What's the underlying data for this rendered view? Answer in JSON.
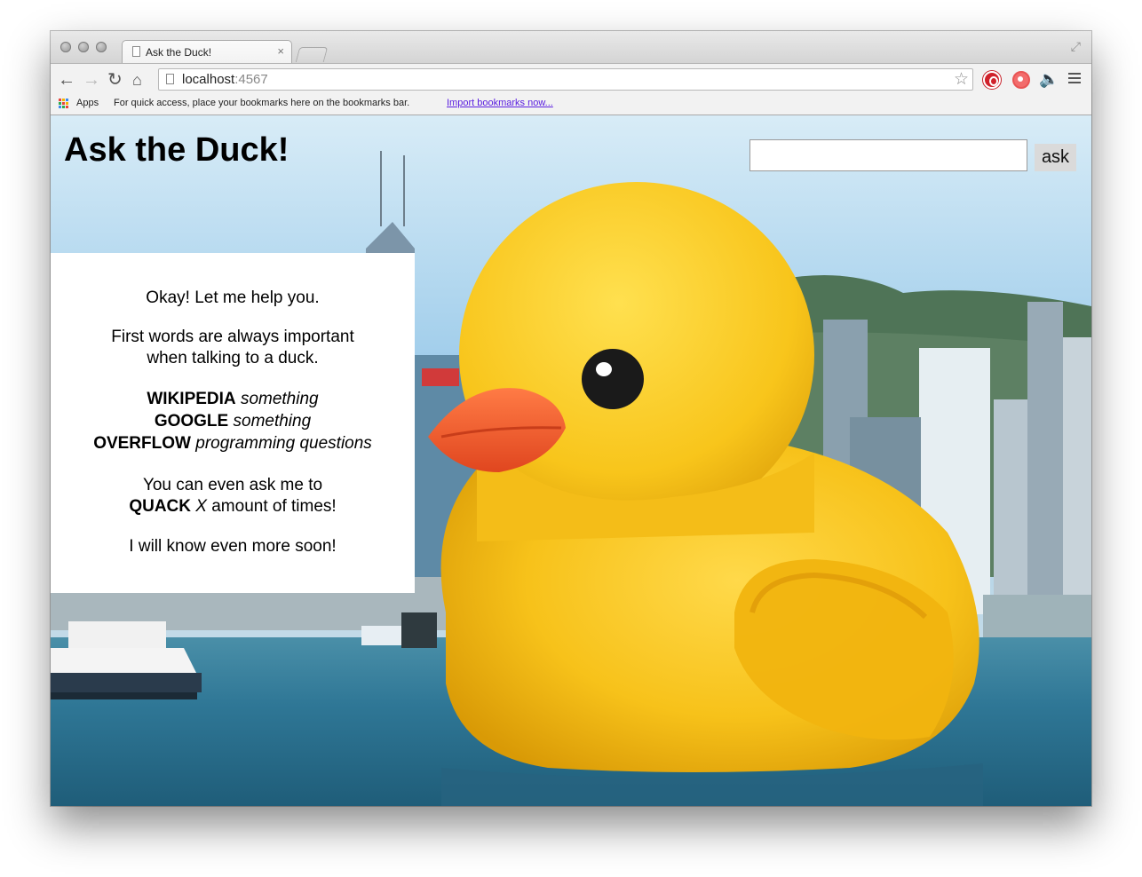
{
  "browser": {
    "tab_title": "Ask the Duck!",
    "tab_close": "×",
    "url_host": "localhost",
    "url_port": ":4567",
    "bookmarks_bar": {
      "apps_label": "Apps",
      "hint": "For quick access, place your bookmarks here on the bookmarks bar.",
      "import_link": "Import bookmarks now..."
    },
    "icons": [
      "back-icon",
      "forward-icon",
      "reload-icon",
      "home-icon",
      "page-icon",
      "star-icon",
      "adblock-icon",
      "extension-icon",
      "speaker-icon",
      "menu-icon",
      "fullscreen-icon"
    ]
  },
  "page": {
    "title": "Ask the Duck!",
    "search": {
      "value": "",
      "placeholder": ""
    },
    "ask_button": "ask",
    "help": {
      "intro": "Okay! Let me help you.",
      "tip_line1": "First words are always important",
      "tip_line2": "when talking to a duck.",
      "commands": [
        {
          "keyword": "WIKIPEDIA",
          "argument": "something"
        },
        {
          "keyword": "GOOGLE",
          "argument": "something"
        },
        {
          "keyword": "OVERFLOW",
          "argument": "programming questions"
        }
      ],
      "quack_line1": "You can even ask me to",
      "quack_keyword": "QUACK",
      "quack_var": "X",
      "quack_rest": "amount of times!",
      "outro": "I will know even more soon!"
    }
  },
  "colors": {
    "duck_yellow": "#f7c21a",
    "beak_orange": "#f0642d",
    "water": "#2a6a88",
    "sky": "#b7d6ea",
    "link": "#5a1ee0"
  }
}
